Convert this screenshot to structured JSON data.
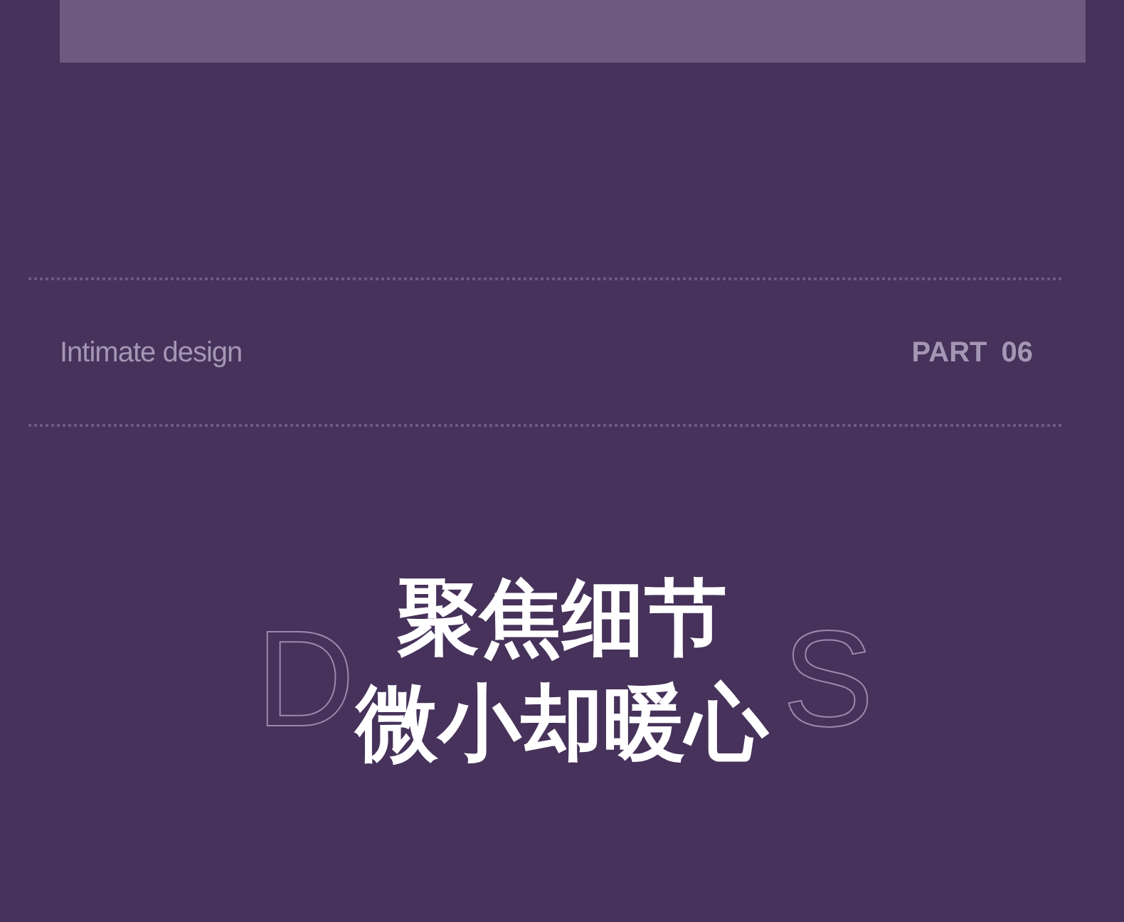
{
  "section_header": {
    "subtitle": "Intimate design",
    "part_label": "PART",
    "part_number": "06"
  },
  "headline": {
    "background_letters": [
      "D",
      "S"
    ],
    "lines": [
      "聚焦细节",
      "微小却暖心"
    ]
  }
}
